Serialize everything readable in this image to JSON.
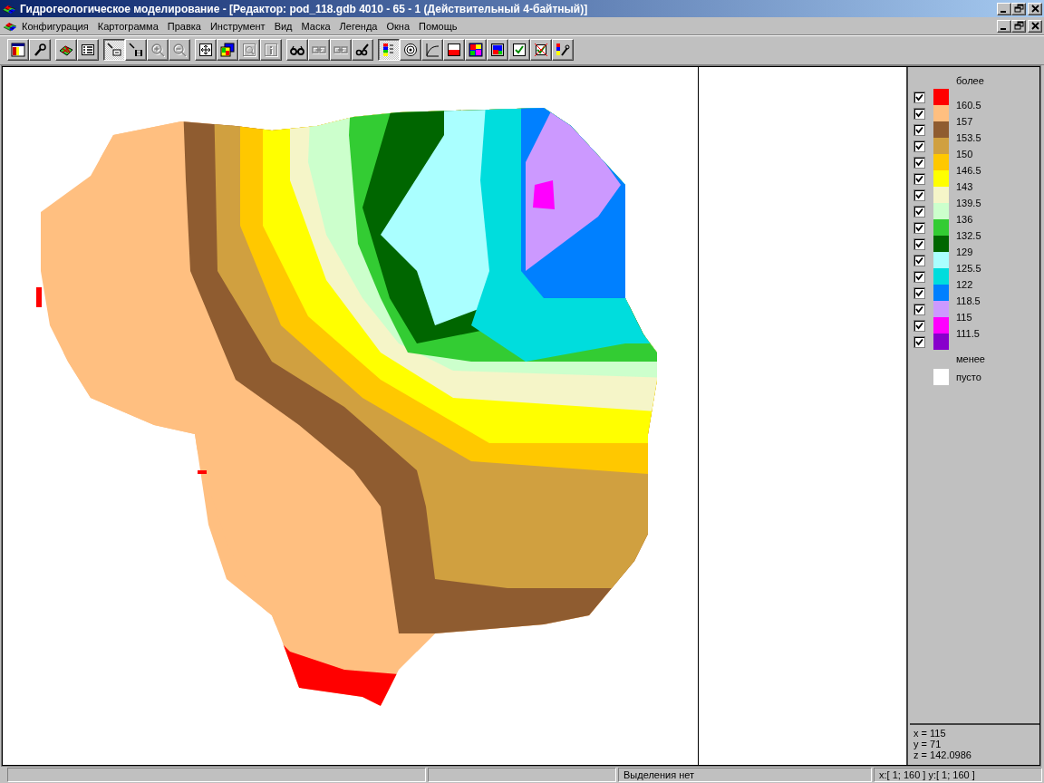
{
  "window": {
    "title": "Гидрогеологическое моделирование - [Редактор: pod_118.gdb 4010 - 65 - 1 (Действительный 4-байтный)]"
  },
  "menu": [
    "Конфигурация",
    "Картограмма",
    "Правка",
    "Инструмент",
    "Вид",
    "Маска",
    "Легенда",
    "Окна",
    "Помощь"
  ],
  "toolbar": {
    "groups": [
      [
        {
          "kind": "window",
          "pressed": false,
          "disabled": false
        },
        {
          "kind": "wrench",
          "pressed": false,
          "disabled": false
        }
      ],
      [
        {
          "kind": "grid",
          "pressed": false,
          "disabled": false
        },
        {
          "kind": "list",
          "pressed": false,
          "disabled": false
        }
      ],
      [
        {
          "kind": "pointer",
          "pressed": true,
          "disabled": false
        },
        {
          "kind": "pointer-grid",
          "pressed": false,
          "disabled": false
        },
        {
          "kind": "zoom-in",
          "pressed": false,
          "disabled": true
        },
        {
          "kind": "zoom-out",
          "pressed": false,
          "disabled": true
        }
      ],
      [
        {
          "kind": "fit",
          "pressed": false,
          "disabled": false
        },
        {
          "kind": "layers",
          "pressed": false,
          "disabled": false
        },
        {
          "kind": "magnifier",
          "pressed": false,
          "disabled": true
        },
        {
          "kind": "info",
          "pressed": false,
          "disabled": true
        }
      ],
      [
        {
          "kind": "glasses",
          "pressed": false,
          "disabled": false
        },
        {
          "kind": "link",
          "pressed": false,
          "disabled": true
        },
        {
          "kind": "link",
          "pressed": false,
          "disabled": true
        },
        {
          "kind": "glasses-wrench",
          "pressed": false,
          "disabled": false
        }
      ],
      [
        {
          "kind": "legend",
          "pressed": true,
          "disabled": false
        },
        {
          "kind": "target",
          "pressed": false,
          "disabled": false
        },
        {
          "kind": "curve",
          "pressed": false,
          "disabled": false
        },
        {
          "kind": "flag",
          "pressed": false,
          "disabled": false
        },
        {
          "kind": "palette",
          "pressed": false,
          "disabled": false
        },
        {
          "kind": "picture",
          "pressed": false,
          "disabled": false
        },
        {
          "kind": "check",
          "pressed": false,
          "disabled": false
        },
        {
          "kind": "check-cross",
          "pressed": false,
          "disabled": false
        },
        {
          "kind": "legend-wrench",
          "pressed": false,
          "disabled": false
        }
      ]
    ]
  },
  "legend": {
    "above_label": "более",
    "items": [
      {
        "color": "#ff0000",
        "checked": true
      },
      {
        "color": "#ffbf80",
        "checked": true
      },
      {
        "color": "#8f5c30",
        "checked": true
      },
      {
        "color": "#d0a040",
        "checked": true
      },
      {
        "color": "#ffc800",
        "checked": true
      },
      {
        "color": "#ffff00",
        "checked": true
      },
      {
        "color": "#f5f5c8",
        "checked": true
      },
      {
        "color": "#ccffcc",
        "checked": true
      },
      {
        "color": "#33cc33",
        "checked": true
      },
      {
        "color": "#006600",
        "checked": true
      },
      {
        "color": "#aaffff",
        "checked": true
      },
      {
        "color": "#00dddd",
        "checked": true
      },
      {
        "color": "#0080ff",
        "checked": true
      },
      {
        "color": "#cc99ff",
        "checked": true
      },
      {
        "color": "#ff00ff",
        "checked": true
      },
      {
        "color": "#8800cc",
        "checked": true
      }
    ],
    "values": [
      "160.5",
      "157",
      "153.5",
      "150",
      "146.5",
      "143",
      "139.5",
      "136",
      "132.5",
      "129",
      "125.5",
      "122",
      "118.5",
      "115",
      "111.5"
    ],
    "below_label": "менее",
    "empty": {
      "color": "#ffffff",
      "label": "пусто"
    }
  },
  "readout": [
    "x = 115",
    "y = 71",
    "z = 142.0986"
  ],
  "status_bar": [
    "Выделения нет",
    "x:[ 1; 160 ] y:[ 1; 160 ]"
  ]
}
